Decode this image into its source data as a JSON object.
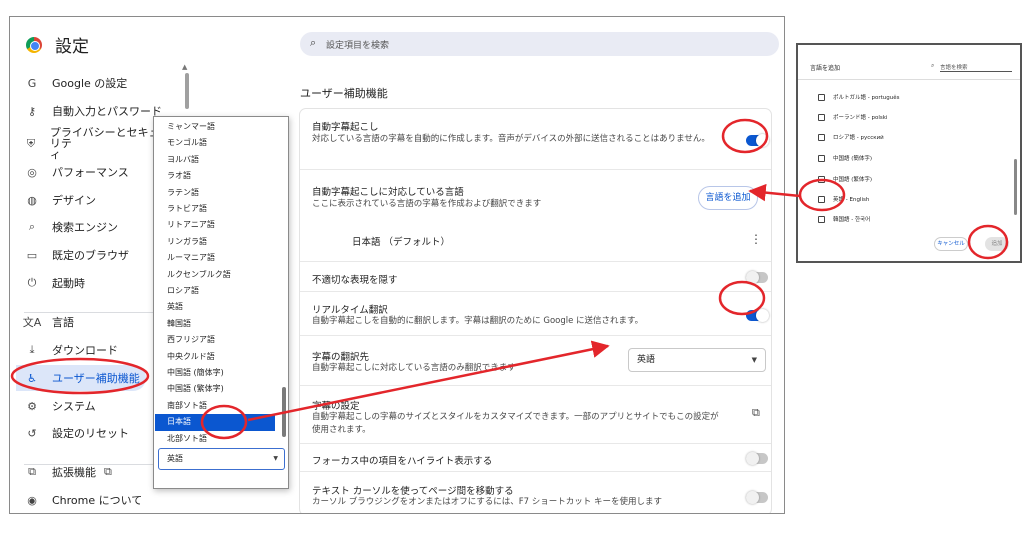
{
  "app": {
    "title": "設定"
  },
  "search": {
    "placeholder": "設定項目を検索"
  },
  "sidebar": {
    "items": [
      {
        "label": "Google の設定",
        "icon": "G"
      },
      {
        "label": "自動入力とパスワード",
        "icon": "⚷"
      },
      {
        "label": "プライバシーとセキュリテ\nィ",
        "icon": "⛨"
      },
      {
        "label": "パフォーマンス",
        "icon": "◎"
      },
      {
        "label": "デザイン",
        "icon": "◍"
      },
      {
        "label": "検索エンジン",
        "icon": "⌕"
      },
      {
        "label": "既定のブラウザ",
        "icon": "▭"
      },
      {
        "label": "起動時",
        "icon": "⏻"
      },
      {
        "label": "言語",
        "icon": "文A"
      },
      {
        "label": "ダウンロード",
        "icon": "⤓"
      },
      {
        "label": "ユーザー補助機能",
        "icon": "♿"
      },
      {
        "label": "システム",
        "icon": "⚙"
      },
      {
        "label": "設定のリセット",
        "icon": "↺"
      },
      {
        "label": "拡張機能",
        "icon": "⧉"
      },
      {
        "label": "Chrome について",
        "icon": "◉"
      }
    ]
  },
  "main": {
    "section_title": "ユーザー補助機能",
    "live_caption": {
      "title": "自動字幕起こし",
      "desc": "対応している言語の字幕を自動的に作成します。音声がデバイスの外部に送信されることはありません。",
      "enabled": true
    },
    "caption_languages": {
      "title": "自動字幕起こしに対応している言語",
      "desc": "ここに表示されている言語の字幕を作成および翻訳できます",
      "add_button": "言語を追加",
      "default_language": "日本語 （デフォルト）",
      "menu_icon": "⋮"
    },
    "hide_profanity": {
      "title": "不適切な表現を隠す",
      "enabled": false
    },
    "live_translate": {
      "title": "リアルタイム翻訳",
      "desc": "自動字幕起こしを自動的に翻訳します。字幕は翻訳のために Google に送信されます。",
      "enabled": true
    },
    "translate_target": {
      "title": "字幕の翻訳先",
      "desc": "自動字幕起こしに対応している言語のみ翻訳できます",
      "value": "英語"
    },
    "caption_settings": {
      "title": "字幕の設定",
      "desc": "自動字幕起こしの字幕のサイズとスタイルをカスタマイズできます。一部のアプリとサイトでもこの設定が使用されます。"
    },
    "highlight_focus": {
      "title": "フォーカス中の項目をハイライト表示する",
      "enabled": false
    },
    "caret_browsing": {
      "title": "テキスト カーソルを使ってページ間を移動する",
      "desc": "カーソル ブラウジングをオンまたはオフにするには、F7 ショートカット キーを使用します",
      "enabled": false
    }
  },
  "dropdown": {
    "options": [
      "ミャンマー語",
      "モンゴル語",
      "ヨルバ語",
      "ラオ語",
      "ラテン語",
      "ラトビア語",
      "リトアニア語",
      "リンガラ語",
      "ルーマニア語",
      "ルクセンブルク語",
      "ロシア語",
      "英語",
      "韓国語",
      "西フリジア語",
      "中央クルド語",
      "中国語 (簡体字)",
      "中国語 (繁体字)",
      "南部ソト語",
      "日本語",
      "北部ソト語"
    ],
    "selected": "日本語",
    "current_value": "英語"
  },
  "dialog": {
    "title": "言語を追加",
    "search_placeholder": "言語を検索",
    "options": [
      "ポルトガル語 - português",
      "ポーランド語 - polski",
      "ロシア語 - русский",
      "中国語 (簡体字)",
      "中国語 (繁体字)",
      "英語 - English",
      "韓国語 - 한국어"
    ],
    "cancel": "キャンセル",
    "add": "追加"
  },
  "colors": {
    "accent": "#0b57d0",
    "annotation": "#e3262b"
  }
}
